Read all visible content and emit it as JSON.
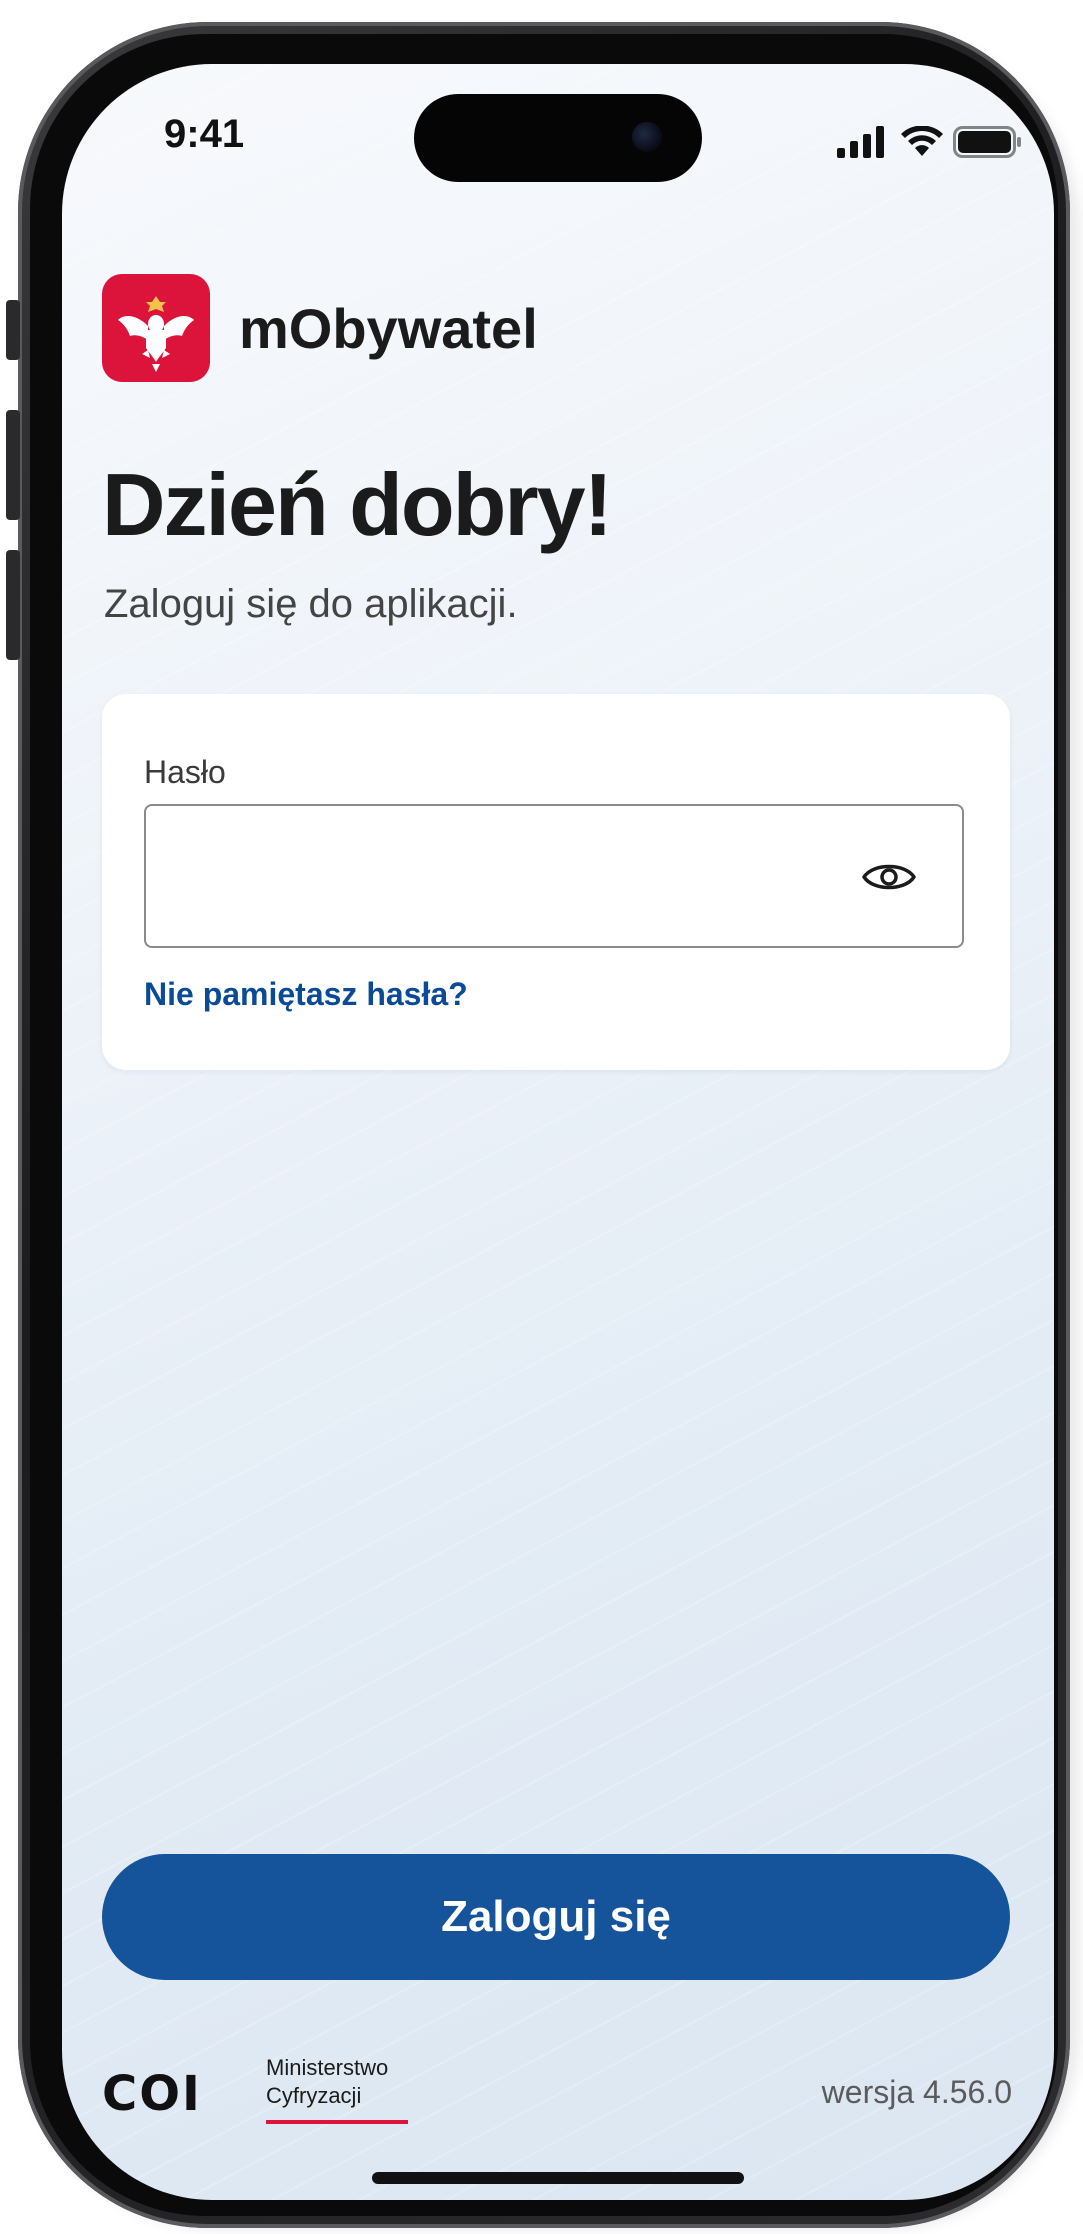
{
  "status_bar": {
    "time": "9:41",
    "icons": [
      "signal-icon",
      "wifi-icon",
      "battery-icon"
    ]
  },
  "brand": {
    "app_name": "mObywatel",
    "logo_icon": "polish-eagle-icon",
    "logo_color": "#dc143c"
  },
  "greeting": {
    "title": "Dzień dobry!",
    "subtitle": "Zaloguj się do aplikacji."
  },
  "login_form": {
    "password_label": "Hasło",
    "password_value": "",
    "show_password_icon": "eye-icon",
    "forgot_password": "Nie pamiętasz hasła?"
  },
  "actions": {
    "login_button": "Zaloguj się",
    "accent_color": "#15539b"
  },
  "footer": {
    "coi_logo": "COI",
    "ministry_line1": "Ministerstwo",
    "ministry_line2": "Cyfryzacji",
    "version": "wersja 4.56.0"
  }
}
